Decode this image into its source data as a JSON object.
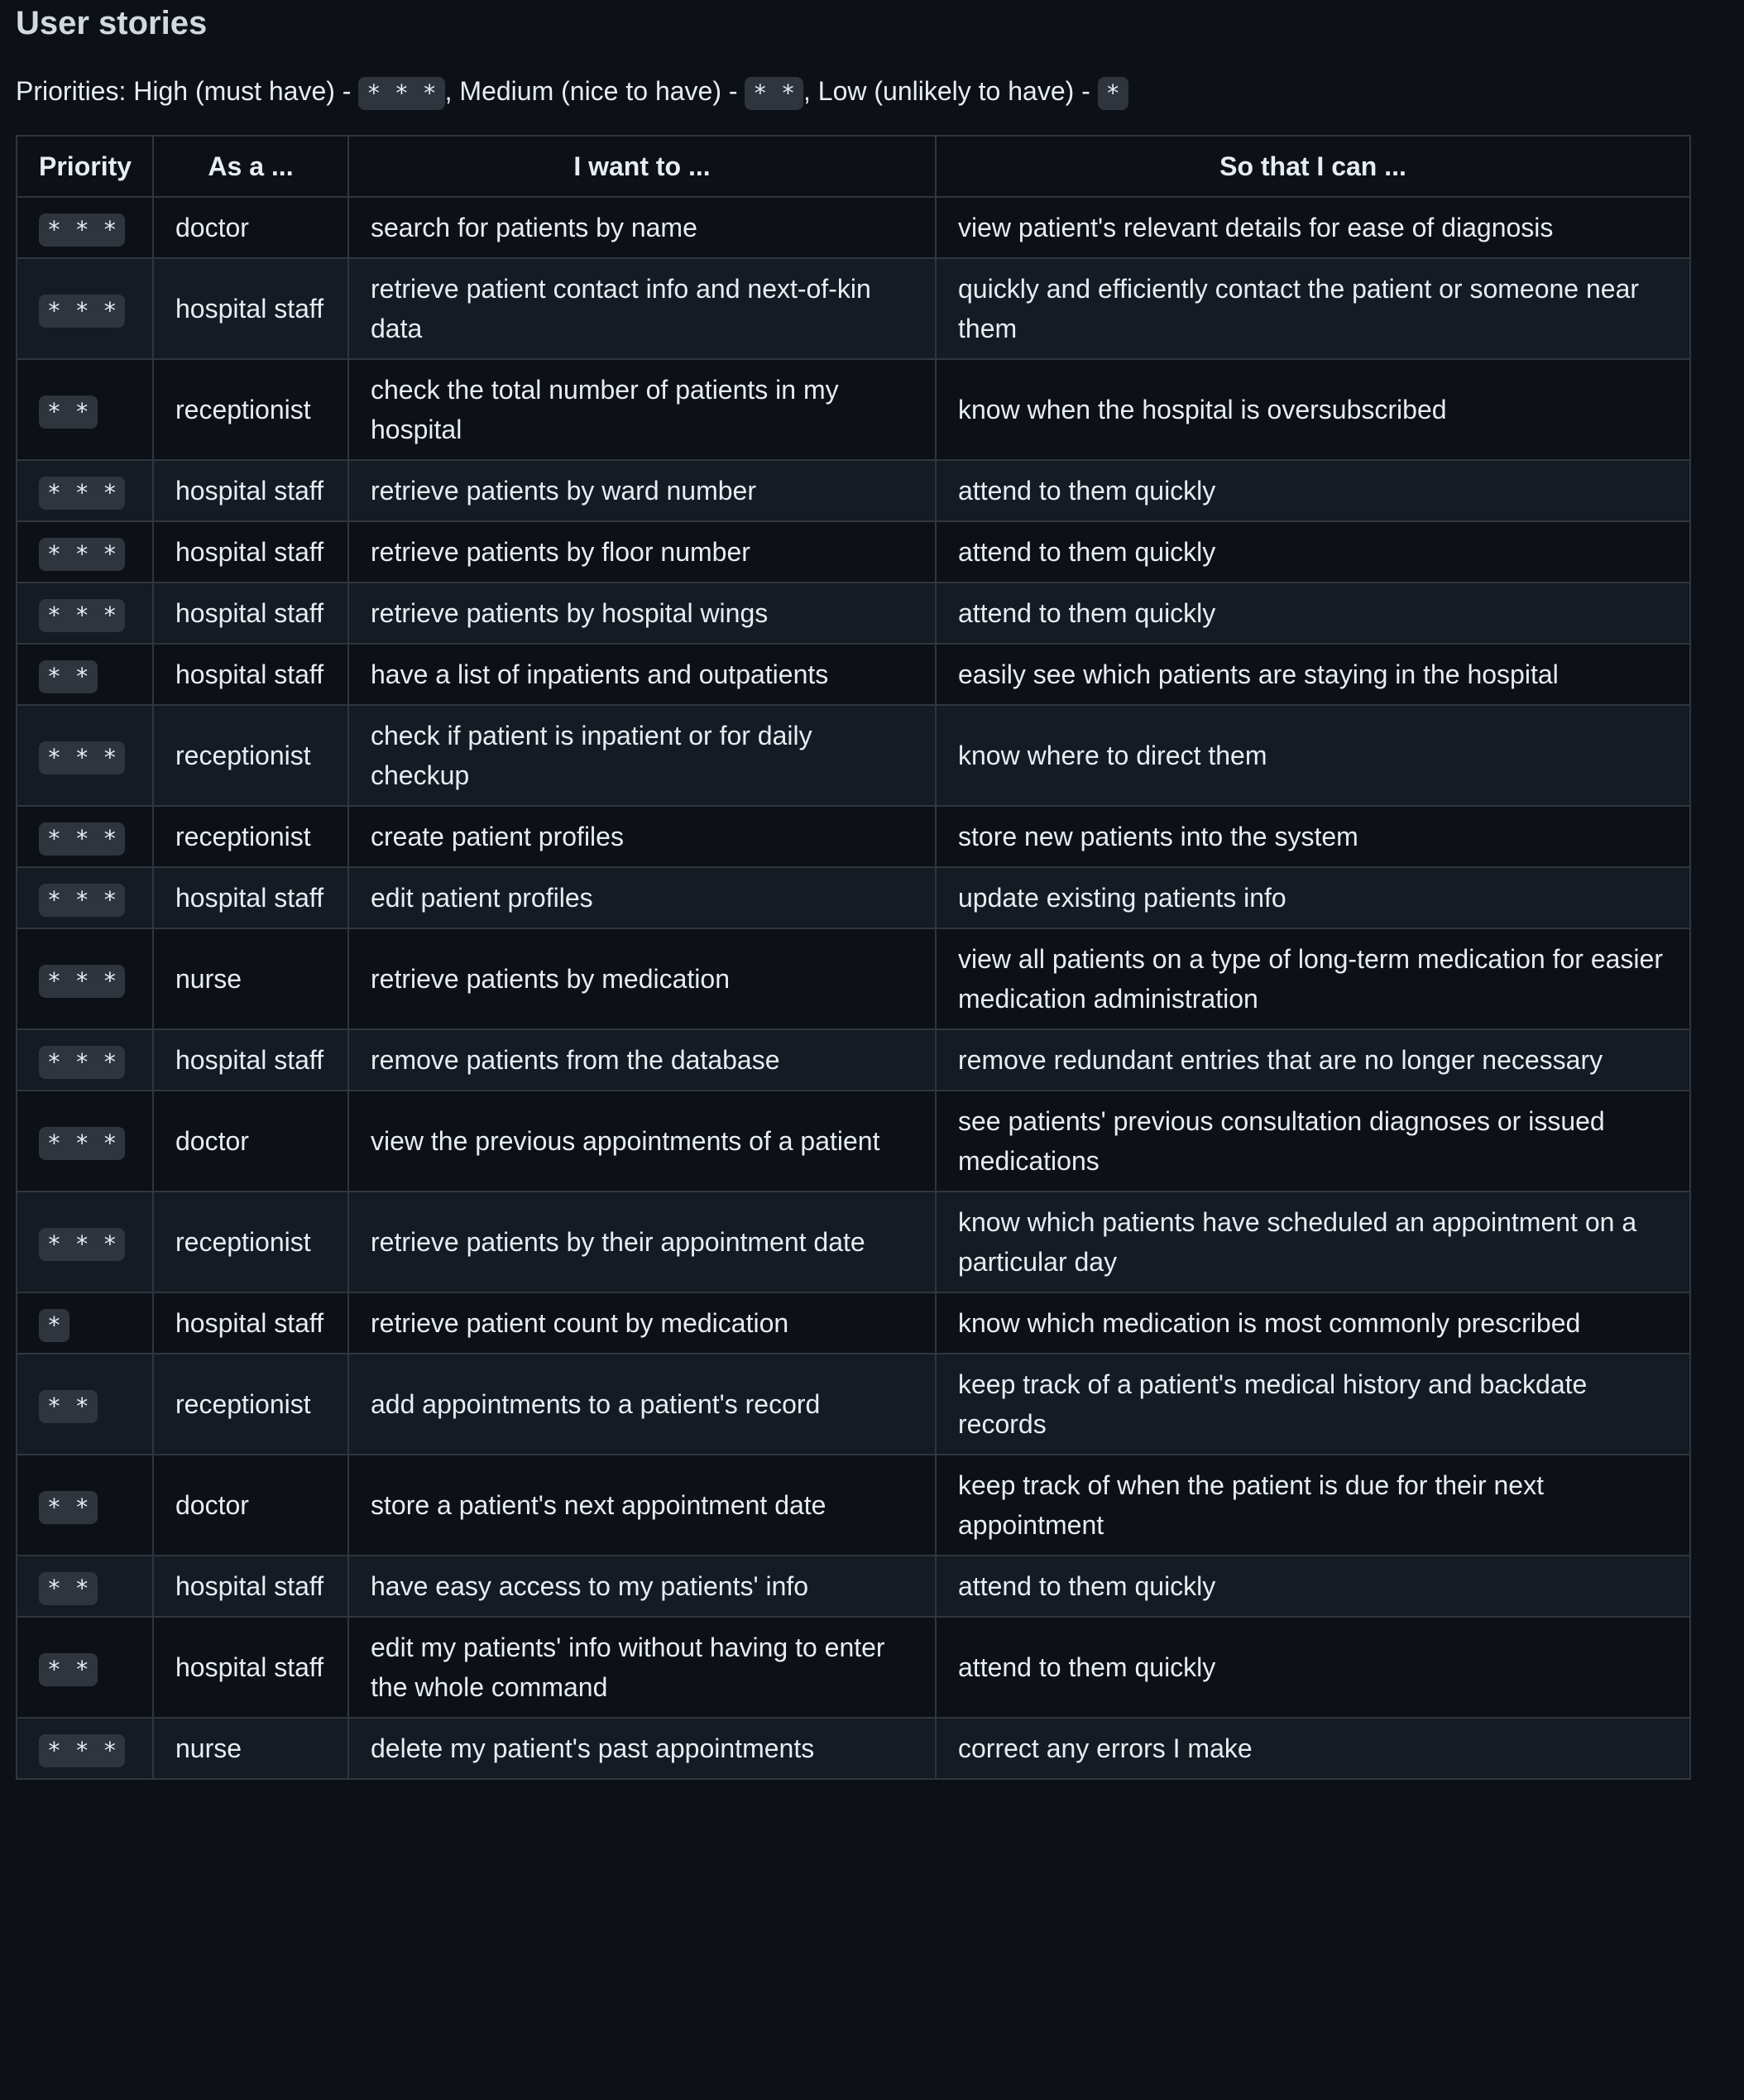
{
  "title": "User stories",
  "priorities": {
    "prefix": "Priorities: High (must have) - ",
    "high_chip": "* * *",
    "medium_text": ", Medium (nice to have) - ",
    "medium_chip": "* *",
    "low_text": ", Low (unlikely to have) - ",
    "low_chip": "*"
  },
  "table": {
    "headers": [
      "Priority",
      "As a ...",
      "I want to ...",
      "So that I can ..."
    ],
    "rows": [
      {
        "priority": "* * *",
        "role": "doctor",
        "want": "search for patients by name",
        "benefit": "view patient's relevant details for ease of diagnosis"
      },
      {
        "priority": "* * *",
        "role": "hospital staff",
        "want": "retrieve patient contact info and next-of-kin data",
        "benefit": "quickly and efficiently contact the patient or someone near them"
      },
      {
        "priority": "* *",
        "role": "receptionist",
        "want": "check the total number of patients in my hospital",
        "benefit": "know when the hospital is oversubscribed"
      },
      {
        "priority": "* * *",
        "role": "hospital staff",
        "want": "retrieve patients by ward number",
        "benefit": "attend to them quickly"
      },
      {
        "priority": "* * *",
        "role": "hospital staff",
        "want": "retrieve patients by floor number",
        "benefit": "attend to them quickly"
      },
      {
        "priority": "* * *",
        "role": "hospital staff",
        "want": "retrieve patients by hospital wings",
        "benefit": "attend to them quickly"
      },
      {
        "priority": "* *",
        "role": "hospital staff",
        "want": "have a list of inpatients and outpatients",
        "benefit": "easily see which patients are staying in the hospital"
      },
      {
        "priority": "* * *",
        "role": "receptionist",
        "want": "check if patient is inpatient or for daily checkup",
        "benefit": "know where to direct them"
      },
      {
        "priority": "* * *",
        "role": "receptionist",
        "want": "create patient profiles",
        "benefit": "store new patients into the system"
      },
      {
        "priority": "* * *",
        "role": "hospital staff",
        "want": "edit patient profiles",
        "benefit": "update existing patients info"
      },
      {
        "priority": "* * *",
        "role": "nurse",
        "want": "retrieve patients by medication",
        "benefit": "view all patients on a type of long-term medication for easier medication administration"
      },
      {
        "priority": "* * *",
        "role": "hospital staff",
        "want": "remove patients from the database",
        "benefit": "remove redundant entries that are no longer necessary"
      },
      {
        "priority": "* * *",
        "role": "doctor",
        "want": "view the previous appointments of a patient",
        "benefit": "see patients' previous consultation diagnoses or issued medications"
      },
      {
        "priority": "* * *",
        "role": "receptionist",
        "want": "retrieve patients by their appointment date",
        "benefit": "know which patients have scheduled an appointment on a particular day"
      },
      {
        "priority": "*",
        "role": "hospital staff",
        "want": "retrieve patient count by medication",
        "benefit": "know which medication is most commonly prescribed"
      },
      {
        "priority": "* *",
        "role": "receptionist",
        "want": "add appointments to a patient's record",
        "benefit": "keep track of a patient's medical history and backdate records"
      },
      {
        "priority": "* *",
        "role": "doctor",
        "want": "store a patient's next appointment date",
        "benefit": "keep track of when the patient is due for their next appointment"
      },
      {
        "priority": "* *",
        "role": "hospital staff",
        "want": "have easy access to my patients' info",
        "benefit": "attend to them quickly"
      },
      {
        "priority": "* *",
        "role": "hospital staff",
        "want": "edit my patients' info without having to enter the whole command",
        "benefit": "attend to them quickly"
      },
      {
        "priority": "* * *",
        "role": "nurse",
        "want": "delete my patient's past appointments",
        "benefit": "correct any errors I make"
      }
    ]
  }
}
